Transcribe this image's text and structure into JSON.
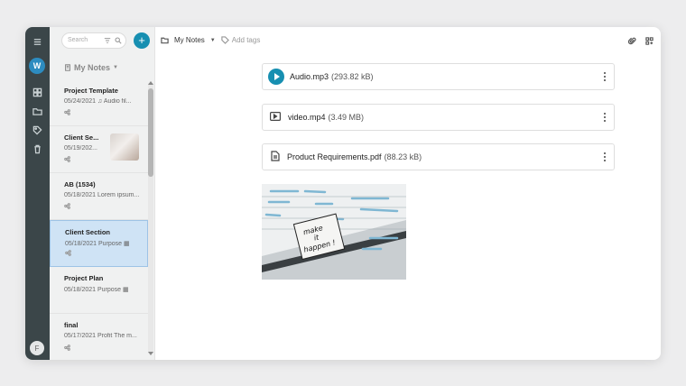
{
  "search": {
    "placeholder": "Search"
  },
  "list": {
    "header": "My Notes",
    "notes": [
      {
        "title": "Project Template",
        "date": "05/24/2021",
        "snippet": "Audio fil..."
      },
      {
        "title": "Client Se...",
        "date": "05/19/202..."
      },
      {
        "title": "AB (1534)",
        "date": "05/18/2021",
        "snippet": "Lorem ipsum..."
      },
      {
        "title": "Client Section",
        "date": "05/18/2021",
        "snippet": "Purpose"
      },
      {
        "title": "Project Plan",
        "date": "05/18/2021",
        "snippet": "Purpose"
      },
      {
        "title": "final",
        "date": "05/17/2021",
        "snippet": "Profit The m..."
      }
    ]
  },
  "rail": {
    "workspace_initial": "W",
    "user_initial": "F"
  },
  "topbar": {
    "notebook": "My Notes",
    "tags_placeholder": "Add tags"
  },
  "attachments": [
    {
      "name": "Audio.mp3",
      "size": "(293.82 kB)"
    },
    {
      "name": "video.mp4",
      "size": "(3.49 MB)"
    },
    {
      "name": "Product Requirements.pdf",
      "size": "(88.23 kB)"
    }
  ],
  "photo": {
    "text_line1": "make",
    "text_line2": "it",
    "text_line3": "happen !"
  },
  "colors": {
    "accent": "#178fb1",
    "rail": "#3b4649",
    "selected": "#cfe3f5"
  }
}
